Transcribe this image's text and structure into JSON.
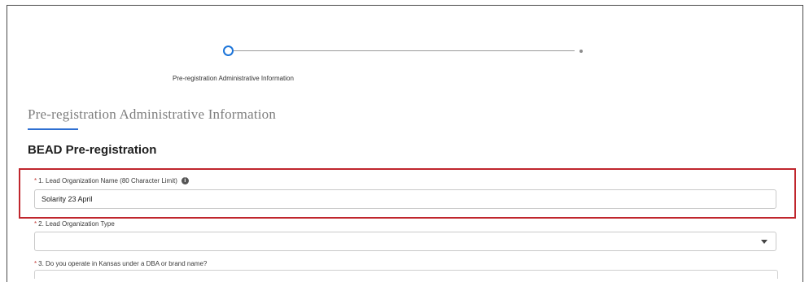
{
  "progress": {
    "steps": [
      {
        "label": "Pre-registration Administrative Information",
        "state": "active"
      },
      {
        "label": "",
        "state": "upcoming"
      }
    ],
    "active_color": "#1b74d9"
  },
  "section": {
    "title": "Pre-registration Administrative Information",
    "underline_color": "#2e6fd1"
  },
  "form": {
    "heading": "BEAD Pre-registration",
    "required_marker": "*",
    "fields": [
      {
        "label": "1. Lead Organization Name (80 Character Limit)",
        "value": "Solarity 23 April",
        "icon": "info-icon",
        "highlighted": true,
        "highlight_color": "#c0262d"
      },
      {
        "label": "2. Lead Organization Type",
        "value": "",
        "icon": "chevron-down-icon"
      },
      {
        "label": "3. Do you operate in Kansas under a DBA or brand name?",
        "value": ""
      }
    ]
  }
}
